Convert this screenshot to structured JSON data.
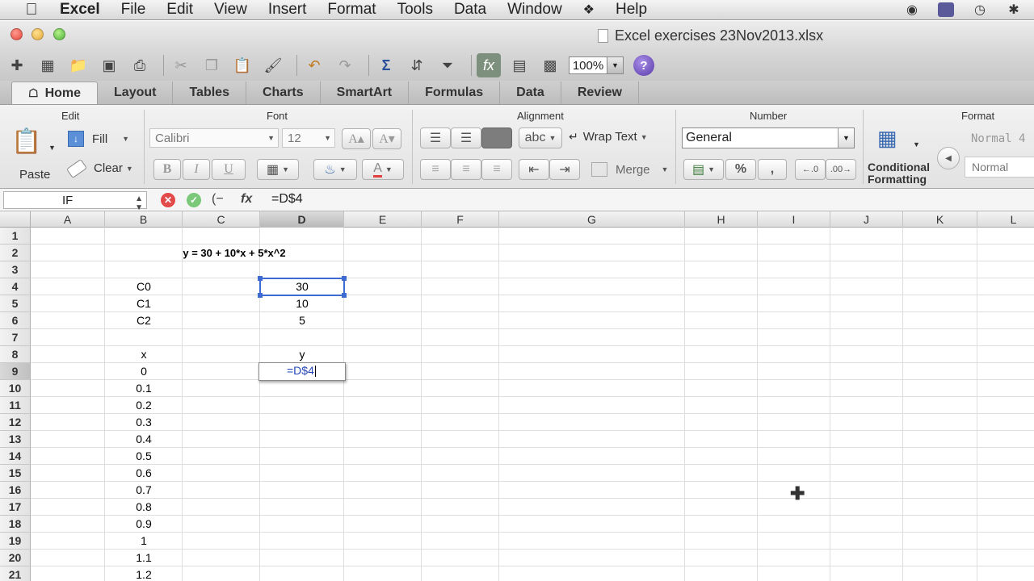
{
  "menubar": {
    "app": "Excel",
    "items": [
      "File",
      "Edit",
      "View",
      "Insert",
      "Format",
      "Tools",
      "Data",
      "Window",
      "Help"
    ]
  },
  "window": {
    "title": "Excel exercises 23Nov2013.xlsx"
  },
  "toolbar": {
    "zoom": "100%",
    "help": "?"
  },
  "ribbon": {
    "tabs": [
      "Home",
      "Layout",
      "Tables",
      "Charts",
      "SmartArt",
      "Formulas",
      "Data",
      "Review"
    ],
    "active_tab": "Home",
    "groups": {
      "edit": {
        "label": "Edit",
        "paste": "Paste",
        "fill": "Fill",
        "clear": "Clear"
      },
      "font": {
        "label": "Font",
        "name": "Calibri",
        "size": "12",
        "bold": "B",
        "italic": "I",
        "underline": "U"
      },
      "alignment": {
        "label": "Alignment",
        "wrap_text": "Wrap Text",
        "merge": "Merge",
        "abc": "abc"
      },
      "number": {
        "label": "Number",
        "format": "General",
        "percent": "%",
        "comma": ","
      },
      "format": {
        "label": "Format",
        "conditional_formatting_line1": "Conditional",
        "conditional_formatting_line2": "Formatting",
        "style1": "Normal 4",
        "style2": "Normal"
      }
    }
  },
  "formula_bar": {
    "name_box": "IF",
    "fx": "fx",
    "content": "=D$4"
  },
  "sheet": {
    "columns": [
      "A",
      "B",
      "C",
      "D",
      "E",
      "F",
      "G",
      "H",
      "I",
      "J",
      "K",
      "L"
    ],
    "rows": [
      "1",
      "2",
      "3",
      "4",
      "5",
      "6",
      "7",
      "8",
      "9",
      "10",
      "11",
      "12",
      "13",
      "14",
      "15",
      "16",
      "17",
      "18",
      "19",
      "20",
      "21"
    ],
    "selected_column": "D",
    "selected_row": "9",
    "equation": "y = 30 + 10*x + 5*x^2",
    "coef_labels": [
      "C0",
      "C1",
      "C2"
    ],
    "coef_values": [
      "30",
      "10",
      "5"
    ],
    "x_header": "x",
    "y_header": "y",
    "x_values": [
      "0",
      "0.1",
      "0.2",
      "0.3",
      "0.4",
      "0.5",
      "0.6",
      "0.7",
      "0.8",
      "0.9",
      "1",
      "1.1",
      "1.2"
    ],
    "editing_text": "=D$4"
  }
}
